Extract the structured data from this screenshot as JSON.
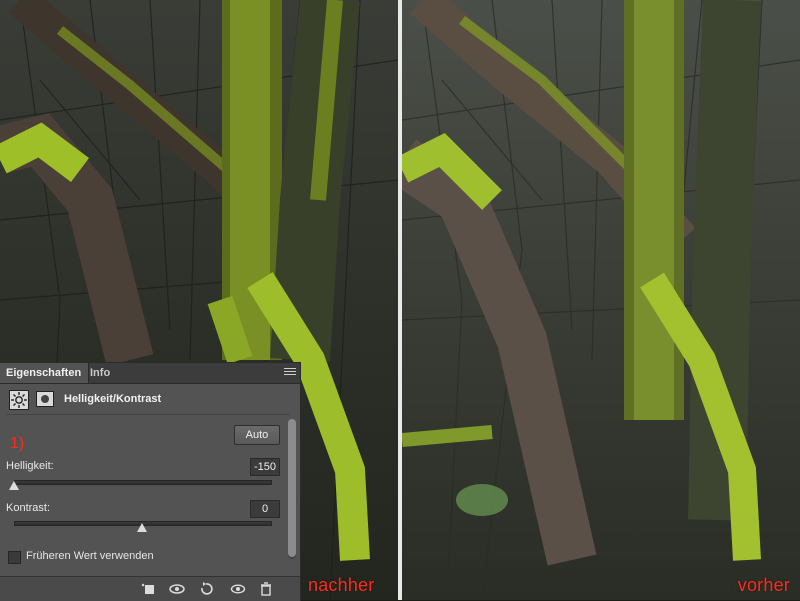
{
  "photo": {
    "after_label": "nachher",
    "before_label": "vorher",
    "label_color": "#ff2a1c"
  },
  "panel": {
    "tabs": [
      "Eigenschaften",
      "Info"
    ],
    "active_tab": "Eigenschaften",
    "adjustment_title": "Helligkeit/Kontrast",
    "icons": [
      "brightness-icon",
      "mask-icon",
      "panel-menu-icon"
    ],
    "auto_label": "Auto",
    "step_marker": "1)",
    "helligkeit": {
      "label": "Helligkeit:",
      "value": "-150",
      "slider_fraction": 0.0
    },
    "kontrast": {
      "label": "Kontrast:",
      "value": "0",
      "slider_fraction": 0.5
    },
    "legacy_checkbox": {
      "label": "Früheren Wert verwenden",
      "checked": false
    },
    "bottom_icons": [
      "clip-to-layer-icon",
      "view-previous-state-icon",
      "reset-icon",
      "visibility-icon",
      "trash-icon"
    ]
  }
}
